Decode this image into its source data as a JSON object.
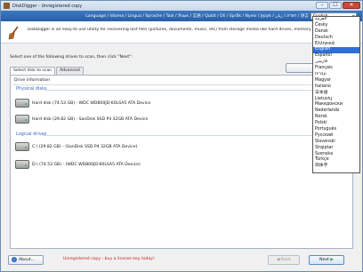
{
  "window": {
    "title": "DiskDigger - Unregistered copy",
    "buttons": [
      "–",
      "☐",
      "✕"
    ]
  },
  "banner": {
    "languages_strip": "Language / Idioma / Lingua / Sprache / Taal / Язык / 言語 / Qubit / Oli / Språk / Nyelv / Język / زبان / ภาษา / 语言",
    "current_language": "English",
    "intro": "DiskDigger is an easy-to use utility for recovering lost files (pictures, documents, music, etc) from storage media like hard drives, memory cards, USB"
  },
  "main": {
    "instruction": "Select one of the following drives to scan, then click \"Next\":",
    "tabs": [
      "Select disk to scan",
      "Advanced"
    ],
    "list_header": "Drive information",
    "groups": [
      {
        "label": "Physical disks",
        "drives": [
          "Hard disk (74.53 GB) - WDC WD800JD-60LSA5 ATA Device",
          "Hard disk (29.82 GB) - SanDisk SSD P4 32GB ATA Device"
        ]
      },
      {
        "label": "Logical drives",
        "drives": [
          "C:\\ (29.82 GB) - (SanDisk SSD P4 32GB ATA Device)",
          "D:\\ (74.53 GB) - (WDC WD800JD-60LSA5 ATA Device)"
        ]
      }
    ]
  },
  "footer": {
    "about_label": "About...",
    "unregistered_text": "Unregistered copy - buy a license key today!",
    "back_label": "Back",
    "next_label": "Next"
  },
  "language_dropdown": {
    "options": [
      "العربية",
      "Česky",
      "Dansk",
      "Deutsch",
      "Ελληνικά",
      "English",
      "Español",
      "فارسی",
      "Français",
      "עברית",
      "Magyar",
      "Italiano",
      "日本語",
      "Lietuvių",
      "Македонски",
      "Nederlands",
      "Norsk",
      "Polski",
      "Português",
      "Русский",
      "Slovenski",
      "Shqiptar",
      "Svenska",
      "Türkçe",
      "简体字"
    ],
    "selected_index": 5
  },
  "colors": {
    "accent": "#2d6fd6",
    "warning": "#c42020",
    "group": "#3a66b8"
  }
}
